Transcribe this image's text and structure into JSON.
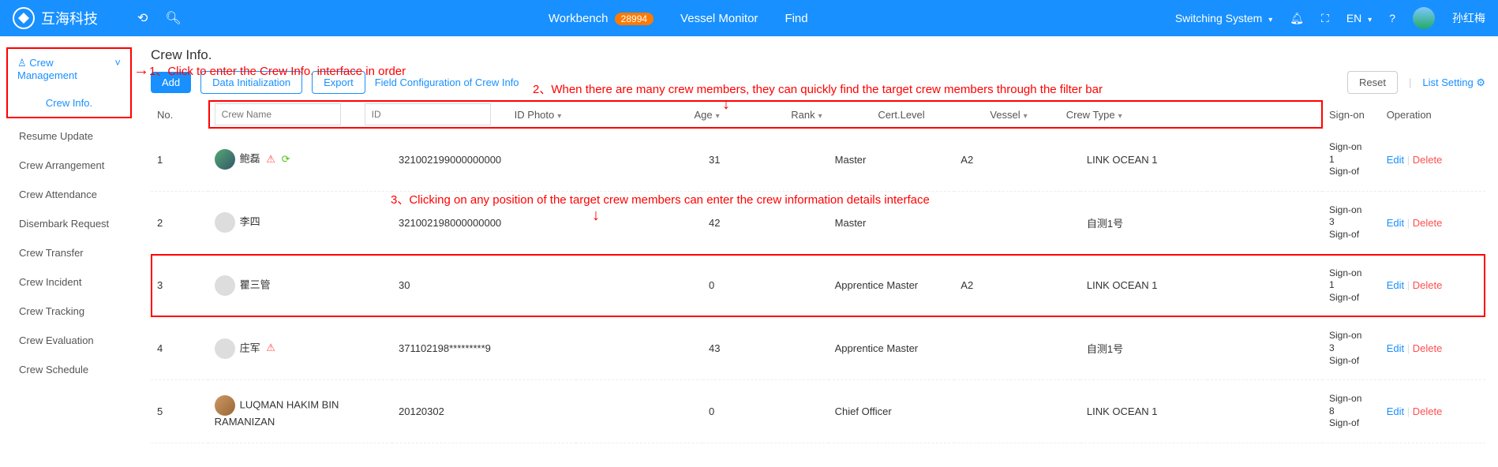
{
  "topbar": {
    "brand": "互海科技",
    "nav": {
      "workbench": "Workbench",
      "badge": "28994",
      "vessel_monitor": "Vessel Monitor",
      "find": "Find"
    },
    "right": {
      "switch": "Switching System",
      "lang": "EN",
      "user": "孙红梅"
    }
  },
  "sidebar": {
    "group_label": "Crew Management",
    "active": "Crew Info.",
    "items": [
      "Resume Update",
      "Crew Arrangement",
      "Crew Attendance",
      "Disembark Request",
      "Crew Transfer",
      "Crew Incident",
      "Crew Tracking",
      "Crew Evaluation",
      "Crew Schedule"
    ]
  },
  "page": {
    "title": "Crew Info."
  },
  "toolbar": {
    "add": "Add",
    "init": "Data Initialization",
    "export": "Export",
    "field_cfg": "Field Configuration of Crew Info",
    "reset": "Reset",
    "list_setting": "List Setting"
  },
  "columns": {
    "no": "No.",
    "crew_name_ph": "Crew Name",
    "id_ph": "ID",
    "id_photo": "ID Photo",
    "age": "Age",
    "rank": "Rank",
    "cert": "Cert.Level",
    "vessel": "Vessel",
    "crew_type": "Crew Type",
    "sign_on": "Sign-on",
    "operation": "Operation"
  },
  "ops": {
    "edit": "Edit",
    "delete": "Delete"
  },
  "rows": [
    {
      "no": "1",
      "name": "鲍磊",
      "warn": true,
      "ok": true,
      "id": "321002199000000000",
      "age": "31",
      "rank": "Master",
      "cert": "A2",
      "vessel": "LINK OCEAN 1",
      "so_a": "Sign-on",
      "so_b": "1",
      "so_c": "Sign-of"
    },
    {
      "no": "2",
      "name": "李四",
      "warn": false,
      "ok": false,
      "id": "321002198000000000",
      "age": "42",
      "rank": "Master",
      "cert": "",
      "vessel": "自测1号",
      "so_a": "Sign-on",
      "so_b": "3",
      "so_c": "Sign-of"
    },
    {
      "no": "3",
      "name": "瞿三管",
      "warn": false,
      "ok": false,
      "id": "30",
      "age": "0",
      "rank": "Apprentice Master",
      "cert": "A2",
      "vessel": "LINK OCEAN 1",
      "so_a": "Sign-on",
      "so_b": "1",
      "so_c": "Sign-of",
      "highlight": true
    },
    {
      "no": "4",
      "name": "庄军",
      "warn": true,
      "ok": false,
      "id": "371102198*********9",
      "age": "43",
      "rank": "Apprentice Master",
      "cert": "",
      "vessel": "自测1号",
      "so_a": "Sign-on",
      "so_b": "3",
      "so_c": "Sign-of"
    },
    {
      "no": "5",
      "name": "LUQMAN HAKIM BIN RAMANIZAN",
      "warn": false,
      "ok": false,
      "id": "20120302",
      "age": "0",
      "rank": "Chief Officer",
      "cert": "",
      "vessel": "LINK OCEAN 1",
      "so_a": "Sign-on",
      "so_b": "8",
      "so_c": "Sign-of"
    }
  ],
  "annotations": {
    "a1": "1、Click to enter the Crew Info. interface in order",
    "a2": "2、When there are many crew members, they can quickly find the target crew members through the filter bar",
    "a3": "3、Clicking on any position of the target crew members can enter the crew information details interface"
  }
}
